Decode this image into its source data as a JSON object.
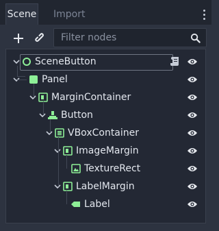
{
  "tabs": [
    {
      "label": "Scene",
      "active": true
    },
    {
      "label": "Import",
      "active": false
    }
  ],
  "toolbar": {
    "add_icon": "plus-icon",
    "link_icon": "link-icon",
    "filter_placeholder": "Filter nodes",
    "search_icon": "search-icon"
  },
  "tree": [
    {
      "label": "SceneButton",
      "icon": "node-circle-icon",
      "color": "#8eef97",
      "has_script": true,
      "expanded": true
    },
    {
      "label": "Panel",
      "icon": "panel-icon",
      "color": "#8eef97",
      "has_script": false,
      "expanded": true
    },
    {
      "label": "MarginContainer",
      "icon": "margin-container-icon",
      "color": "#8eef97",
      "has_script": false,
      "expanded": true
    },
    {
      "label": "Button",
      "icon": "button-icon",
      "color": "#8eef97",
      "has_script": false,
      "expanded": true
    },
    {
      "label": "VBoxContainer",
      "icon": "vbox-container-icon",
      "color": "#8eef97",
      "has_script": false,
      "expanded": true
    },
    {
      "label": "ImageMargin",
      "icon": "margin-container-icon",
      "color": "#8eef97",
      "has_script": false,
      "expanded": true
    },
    {
      "label": "TextureRect",
      "icon": "texture-rect-icon",
      "color": "#8eef97",
      "has_script": false,
      "expanded": false
    },
    {
      "label": "LabelMargin",
      "icon": "margin-container-icon",
      "color": "#8eef97",
      "has_script": false,
      "expanded": true
    },
    {
      "label": "Label",
      "icon": "label-icon",
      "color": "#8eef97",
      "has_script": false,
      "expanded": false
    }
  ],
  "colors": {
    "node_green": "#8eef97",
    "background": "#2d3340",
    "panel": "#232834"
  }
}
